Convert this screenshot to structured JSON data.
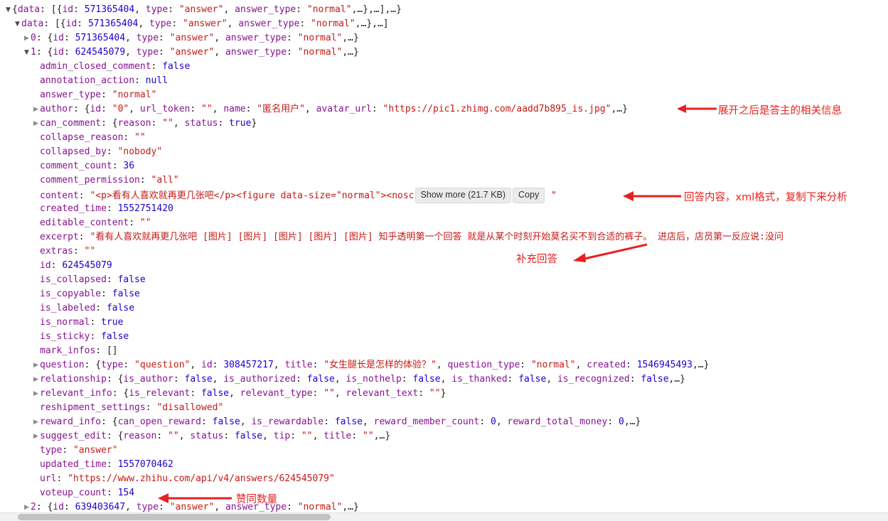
{
  "panel": {
    "name": "devtools-json-tree",
    "font_colors": {
      "key": "#881391",
      "string": "#c41a16",
      "number": "#1c00cf",
      "boolean": "#1c00cf",
      "null": "#1c00cf",
      "punctuation": "#222222",
      "annotation_red": "#e8201e"
    }
  },
  "rows": [
    {
      "tri": "open",
      "indent": 0,
      "text": "{data: [{id: 571365404, type: \"answer\", answer_type: \"normal\",…},…],…}"
    },
    {
      "tri": "open",
      "indent": 1,
      "key": "data",
      "text": "[{id: 571365404, type: \"answer\", answer_type: \"normal\",…},…]"
    },
    {
      "tri": "closed",
      "indent": 2,
      "key": "0",
      "text": "{id: 571365404, type: \"answer\", answer_type: \"normal\",…}"
    },
    {
      "tri": "open",
      "indent": 2,
      "key": "1",
      "text": "{id: 624545079, type: \"answer\", answer_type: \"normal\",…}"
    },
    {
      "tri": "none",
      "indent": 3,
      "key": "admin_closed_comment",
      "value": "false",
      "vtype": "bool"
    },
    {
      "tri": "none",
      "indent": 3,
      "key": "annotation_action",
      "value": "null",
      "vtype": "null"
    },
    {
      "tri": "none",
      "indent": 3,
      "key": "answer_type",
      "value": "\"normal\"",
      "vtype": "str"
    },
    {
      "tri": "closed",
      "indent": 3,
      "key": "author",
      "text": "{id: \"0\", url_token: \"\", name: \"匿名用户\", avatar_url: \"https://pic1.zhimg.com/aadd7b895_is.jpg\",…}"
    },
    {
      "tri": "closed",
      "indent": 3,
      "key": "can_comment",
      "text": "{reason: \"\", status: true}"
    },
    {
      "tri": "none",
      "indent": 3,
      "key": "collapse_reason",
      "value": "\"\"",
      "vtype": "str"
    },
    {
      "tri": "none",
      "indent": 3,
      "key": "collapsed_by",
      "value": "\"nobody\"",
      "vtype": "str"
    },
    {
      "tri": "none",
      "indent": 3,
      "key": "comment_count",
      "value": "36",
      "vtype": "num"
    },
    {
      "tri": "none",
      "indent": 3,
      "key": "comment_permission",
      "value": "\"all\"",
      "vtype": "str"
    },
    {
      "tri": "none",
      "indent": 3,
      "key": "content",
      "special": "content"
    },
    {
      "tri": "none",
      "indent": 3,
      "key": "created_time",
      "value": "1552751420",
      "vtype": "num"
    },
    {
      "tri": "none",
      "indent": 3,
      "key": "editable_content",
      "value": "\"\"",
      "vtype": "str"
    },
    {
      "tri": "none",
      "indent": 3,
      "key": "excerpt",
      "value": "\"看有人喜欢就再更几张吧 [图片] [图片] [图片] [图片] [图片] 知乎透明第一个回答 就是从某个时刻开始莫名买不到合适的裤子。 进店后，店员第一反应说:没问",
      "vtype": "str"
    },
    {
      "tri": "none",
      "indent": 3,
      "key": "extras",
      "value": "\"\"",
      "vtype": "str"
    },
    {
      "tri": "none",
      "indent": 3,
      "key": "id",
      "value": "624545079",
      "vtype": "num"
    },
    {
      "tri": "none",
      "indent": 3,
      "key": "is_collapsed",
      "value": "false",
      "vtype": "bool"
    },
    {
      "tri": "none",
      "indent": 3,
      "key": "is_copyable",
      "value": "false",
      "vtype": "bool"
    },
    {
      "tri": "none",
      "indent": 3,
      "key": "is_labeled",
      "value": "false",
      "vtype": "bool"
    },
    {
      "tri": "none",
      "indent": 3,
      "key": "is_normal",
      "value": "true",
      "vtype": "bool"
    },
    {
      "tri": "none",
      "indent": 3,
      "key": "is_sticky",
      "value": "false",
      "vtype": "bool"
    },
    {
      "tri": "none",
      "indent": 3,
      "key": "mark_infos",
      "value": "[]",
      "vtype": "plain"
    },
    {
      "tri": "closed",
      "indent": 3,
      "key": "question",
      "text": "{type: \"question\", id: 308457217, title: \"女生腿长是怎样的体验？\", question_type: \"normal\", created: 1546945493,…}"
    },
    {
      "tri": "closed",
      "indent": 3,
      "key": "relationship",
      "text": "{is_author: false, is_authorized: false, is_nothelp: false, is_thanked: false, is_recognized: false,…}"
    },
    {
      "tri": "closed",
      "indent": 3,
      "key": "relevant_info",
      "text": "{is_relevant: false, relevant_type: \"\", relevant_text: \"\"}"
    },
    {
      "tri": "none",
      "indent": 3,
      "key": "reshipment_settings",
      "value": "\"disallowed\"",
      "vtype": "str"
    },
    {
      "tri": "closed",
      "indent": 3,
      "key": "reward_info",
      "text": "{can_open_reward: false, is_rewardable: false, reward_member_count: 0, reward_total_money: 0,…}"
    },
    {
      "tri": "closed",
      "indent": 3,
      "key": "suggest_edit",
      "text": "{reason: \"\", status: false, tip: \"\", title: \"\",…}"
    },
    {
      "tri": "none",
      "indent": 3,
      "key": "type",
      "value": "\"answer\"",
      "vtype": "str"
    },
    {
      "tri": "none",
      "indent": 3,
      "key": "updated_time",
      "value": "1557070462",
      "vtype": "num"
    },
    {
      "tri": "none",
      "indent": 3,
      "key": "url",
      "value": "\"https://www.zhihu.com/api/v4/answers/624545079\"",
      "vtype": "str"
    },
    {
      "tri": "none",
      "indent": 3,
      "key": "voteup_count",
      "value": "154",
      "vtype": "num"
    },
    {
      "tri": "closed",
      "indent": 2,
      "key": "2",
      "text": "{id: 639403647, type: \"answer\", answer_type: \"normal\",…}"
    }
  ],
  "content_row": {
    "key": "content",
    "prefix": "\"<p>看有人喜欢就再更几张吧</p><figure data-size=\"normal\"><nosc",
    "show_more_label": "Show more (21.7 KB)",
    "copy_label": "Copy",
    "suffix": "\""
  },
  "annotations": [
    {
      "id": "author-note",
      "text": "展开之后是答主的相关信息"
    },
    {
      "id": "content-note",
      "text": "回答内容，xml格式，复制下来分析"
    },
    {
      "id": "excerpt-note",
      "text": "补充回答"
    },
    {
      "id": "voteup-note",
      "text": "赞同数量"
    }
  ]
}
